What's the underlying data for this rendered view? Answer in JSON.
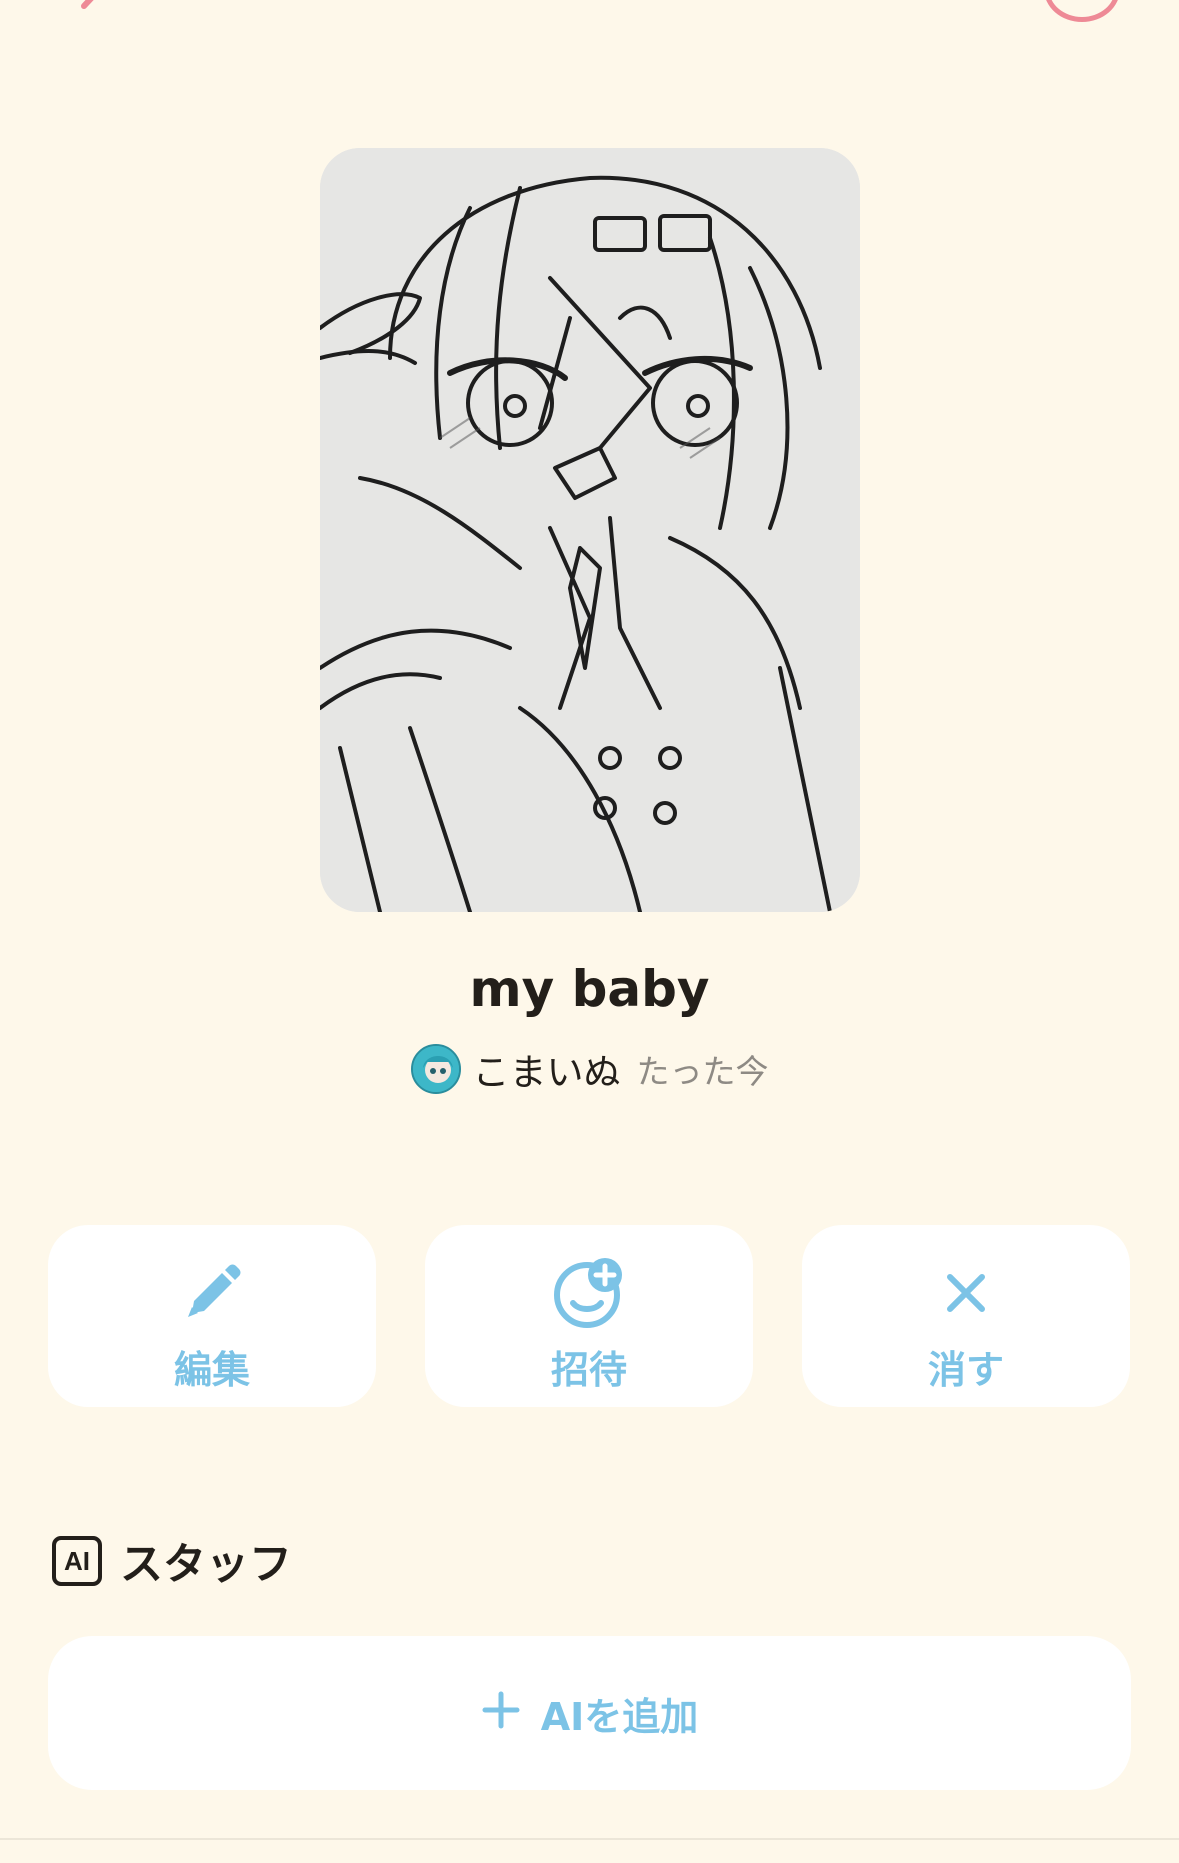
{
  "header": {
    "back_icon": "chevron-left-icon",
    "right_icon": "circle-icon",
    "accent_color": "#EE8A96"
  },
  "room": {
    "title": "my baby",
    "author": "こまいぬ",
    "time": "たった今"
  },
  "actions": {
    "edit_label": "編集",
    "invite_label": "招待",
    "delete_label": "消す",
    "accent_color": "#7CC3E6"
  },
  "staff": {
    "badge": "AI",
    "title": "スタッフ",
    "add_label": "AIを追加"
  }
}
